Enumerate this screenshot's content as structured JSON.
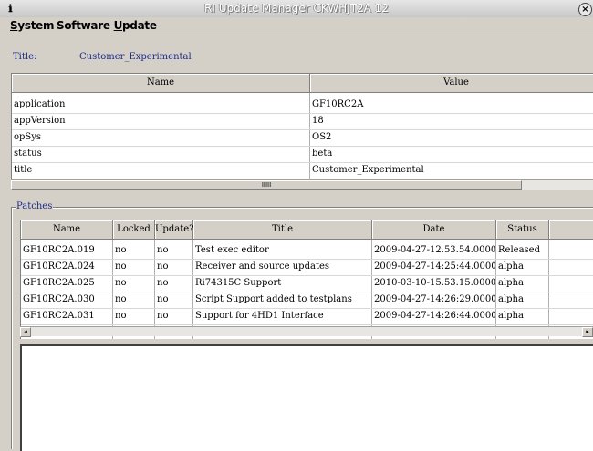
{
  "window": {
    "title": "RI Update Manager CKWHJT2A 12",
    "app_icon": "ri-app-icon",
    "close_icon": "close-icon"
  },
  "menu": {
    "items": [
      {
        "label": "System",
        "mnemonic": "S"
      },
      {
        "label": "Software Update",
        "mnemonic": "U"
      }
    ]
  },
  "header": {
    "title_label": "Title:",
    "title_value": "Customer_Experimental"
  },
  "properties": {
    "columns": [
      "Name",
      "Value"
    ],
    "rows": [
      {
        "name": "application",
        "value": "GF10RC2A"
      },
      {
        "name": "appVersion",
        "value": "18"
      },
      {
        "name": "opSys",
        "value": "OS2"
      },
      {
        "name": "status",
        "value": "beta"
      },
      {
        "name": "title",
        "value": "Customer_Experimental"
      }
    ],
    "scroll_thumb_label": "IIIII"
  },
  "patches": {
    "group_label": "Patches",
    "columns": [
      "Name",
      "Locked",
      "Update?",
      "Title",
      "Date",
      "Status"
    ],
    "rows": [
      {
        "name": "GF10RC2A.019",
        "locked": "no",
        "update": "no",
        "title": "Test exec editor",
        "date": "2009-04-27-12.53.54.0000",
        "status": "Released"
      },
      {
        "name": "GF10RC2A.024",
        "locked": "no",
        "update": "no",
        "title": "Receiver and source updates",
        "date": "2009-04-27-14:25:44.0000",
        "status": "alpha"
      },
      {
        "name": "GF10RC2A.025",
        "locked": "no",
        "update": "no",
        "title": "Ri74315C Support",
        "date": "2010-03-10-15.53.15.0000",
        "status": "alpha"
      },
      {
        "name": "GF10RC2A.030",
        "locked": "no",
        "update": "no",
        "title": "Script Support added to testplans",
        "date": "2009-04-27-14:26:29.0000",
        "status": "alpha"
      },
      {
        "name": "GF10RC2A.031",
        "locked": "no",
        "update": "no",
        "title": "Support for 4HD1 Interface",
        "date": "2009-04-27-14:26:44.0000",
        "status": "alpha"
      }
    ]
  }
}
